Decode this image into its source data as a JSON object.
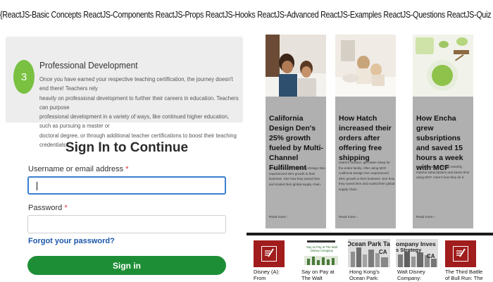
{
  "ticker": "{ReactJS-Basic Concepts ReactJS-Components ReactJS-Props ReactJS-Hooks ReactJS-Advanced ReactJS-Examples ReactJS-Questions ReactJS-Quiz ReactJS-Tutorial Web Development Web Techno}",
  "professional_dev": {
    "step": "3",
    "title": "Professional Development",
    "body_lines": [
      "Once you have earned your respective teaching certification, the journey doesn't end there! Teachers rely",
      "heavily on professional development to further their careers in education. Teachers can purpose",
      "professional development in a variety of ways, like continued higher education, such as pursuing a master or",
      "doctoral degree, or through additional teacher certifications to boost their teaching credentials."
    ]
  },
  "signin": {
    "title": "Sign In to Continue",
    "username_label": "Username or email address",
    "password_label": "Password",
    "required_mark": "*",
    "forgot": "Forgot your password?",
    "button": "Sign in"
  },
  "cards": [
    {
      "title": "California Design Den's 25% growth fueled by Multi-Channel Fulfillment",
      "body": "After using MCF, California Design Den experienced 25% growth in their business. See how they saved time and scaled their global supply chain.",
      "more": "Read more ›"
    },
    {
      "title": "How Hatch increased their orders after offering free shipping",
      "body": "Hatch's mission: get better sleep for the entire family. After using MCF, California Design Den experienced 25% growth in their business. See how they saved time and scaled their global supply chain.",
      "more": "Read more ›"
    },
    {
      "title": "How Encha grew subsriptions and saved 15 hours a week with MCF",
      "body": "Encha provides reliable monthly matcha subscriptions and saves time using MCF. Here's how they do it.",
      "more": "Read more ›"
    }
  ],
  "thumbs": [
    {
      "caption_1": "Disney (A):",
      "caption_2": "From"
    },
    {
      "caption_1": "Say on Pay at",
      "caption_2": "The Walt",
      "img_title": "Say on Pay at The Walt Disney Company"
    },
    {
      "caption_1": "Hong Kong's",
      "caption_2": "Ocean Park:",
      "img_title": "Ocean Park Tal",
      "img_sub": "CA"
    },
    {
      "caption_1": "Walt Disney",
      "caption_2": "Company:",
      "img_title": "ompany Inves",
      "img_title2": "s Strategy",
      "img_sub": "CA"
    },
    {
      "caption_1": "The Third Battle",
      "caption_2": "of Bull Run: The"
    }
  ],
  "colors": {
    "step_green": "#7ac142",
    "button_green": "#1e8e36",
    "link_blue": "#1a56a8",
    "focus_blue": "#3b7fd1",
    "card_grey": "#b0b0b0",
    "book_red": "#a11c1c"
  }
}
